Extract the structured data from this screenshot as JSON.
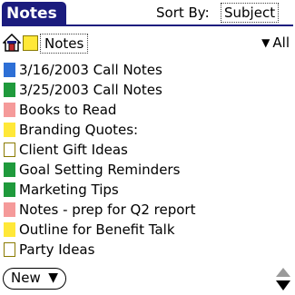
{
  "app": {
    "title": "Notes"
  },
  "sort": {
    "label": "Sort By:",
    "value": "Subject"
  },
  "category": {
    "name": "Notes",
    "filter": "All"
  },
  "notes": [
    {
      "title": "3/16/2003 Call Notes",
      "color": "#2d6fd6"
    },
    {
      "title": "3/25/2003 Call Notes",
      "color": "#1f9a3c"
    },
    {
      "title": "Books to Read",
      "color": "#f59a9a"
    },
    {
      "title": "Branding Quotes:",
      "color": "#ffe838"
    },
    {
      "title": "Client Gift Ideas",
      "color": "#ffffff"
    },
    {
      "title": "Goal Setting Reminders",
      "color": "#1f9a3c"
    },
    {
      "title": "Marketing Tips",
      "color": "#1f9a3c"
    },
    {
      "title": "Notes - prep for Q2 report",
      "color": "#f59a9a"
    },
    {
      "title": "Outline for Benefit Talk",
      "color": "#ffe838"
    },
    {
      "title": "Party Ideas",
      "color": "#ffffff"
    }
  ],
  "buttons": {
    "new": "New"
  },
  "colors": {
    "title_bar": "#1b1c7e",
    "category_folder": "#ffe838"
  }
}
